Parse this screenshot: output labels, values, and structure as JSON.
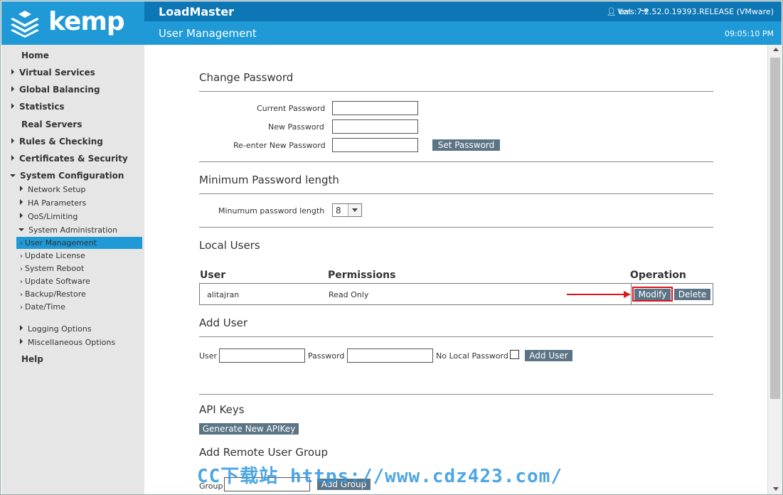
{
  "header": {
    "logo_text": "kemp",
    "app_title": "LoadMaster",
    "user": "bal",
    "version": "Vers:7.2.52.0.19393.RELEASE (VMware)",
    "page_title": "User Management",
    "clock": "09:05:10 PM"
  },
  "sidebar": {
    "home": "Home",
    "virtual_services": "Virtual Services",
    "global_balancing": "Global Balancing",
    "statistics": "Statistics",
    "real_servers": "Real Servers",
    "rules_checking": "Rules & Checking",
    "certificates_security": "Certificates & Security",
    "system_configuration": "System Configuration",
    "network_setup": "Network Setup",
    "ha_parameters": "HA Parameters",
    "qos_limiting": "QoS/Limiting",
    "system_administration": "System Administration",
    "user_management": "User Management",
    "update_license": "Update License",
    "system_reboot": "System Reboot",
    "update_software": "Update Software",
    "backup_restore": "Backup/Restore",
    "date_time": "Date/Time",
    "logging_options": "Logging Options",
    "misc_options": "Miscellaneous Options",
    "help": "Help"
  },
  "change_password": {
    "title": "Change Password",
    "current_label": "Current Password",
    "new_label": "New Password",
    "reenter_label": "Re-enter New Password",
    "set_button": "Set Password"
  },
  "min_password": {
    "title": "Minimum Password length",
    "label": "Minumum password length",
    "value": "8"
  },
  "local_users": {
    "title": "Local Users",
    "col_user": "User",
    "col_permissions": "Permissions",
    "col_operation": "Operation",
    "rows": [
      {
        "user": "alitajran",
        "permissions": "Read Only",
        "modify": "Modify",
        "delete": "Delete"
      }
    ]
  },
  "add_user": {
    "title": "Add User",
    "user_label": "User",
    "password_label": "Password",
    "no_local_label": "No Local Password",
    "add_button": "Add User"
  },
  "api_keys": {
    "title": "API Keys",
    "generate_button": "Generate New APIKey"
  },
  "remote_group": {
    "title": "Add Remote User Group",
    "group_label": "Group",
    "add_button": "Add Group"
  },
  "watermark": "CC下载站 https://www.cdz423.com/",
  "colors": {
    "brand_blue": "#1f9ad6",
    "topbar_blue": "#0d77b5",
    "button": "#5b7486",
    "highlight_red": "#e0141c"
  }
}
